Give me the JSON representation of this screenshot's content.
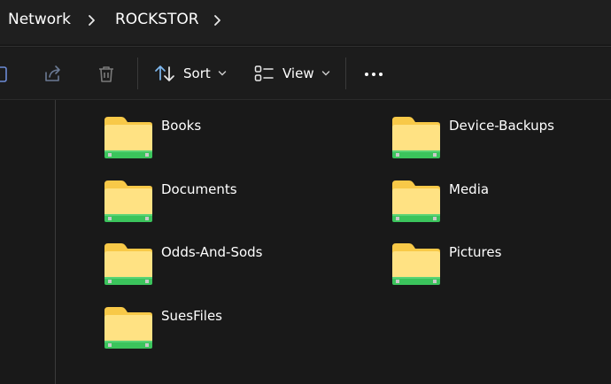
{
  "breadcrumb": {
    "items": [
      "Network",
      "ROCKSTOR"
    ]
  },
  "toolbar": {
    "sort_label": "Sort",
    "view_label": "View",
    "icons": [
      "copy-path-icon",
      "share-icon",
      "delete-icon",
      "sort-icon",
      "view-icon",
      "more-icon"
    ]
  },
  "folders": [
    {
      "name": "Books"
    },
    {
      "name": "Device-Backups"
    },
    {
      "name": "Documents"
    },
    {
      "name": "Media"
    },
    {
      "name": "Odds-And-Sods"
    },
    {
      "name": "Pictures"
    },
    {
      "name": "SuesFiles"
    }
  ],
  "colors": {
    "background": "#191919",
    "folder_yellow": "#f8c948",
    "folder_front": "#ffe283",
    "drive_stripe": "#3bc45c",
    "accent_blue": "#7fb8ef"
  }
}
